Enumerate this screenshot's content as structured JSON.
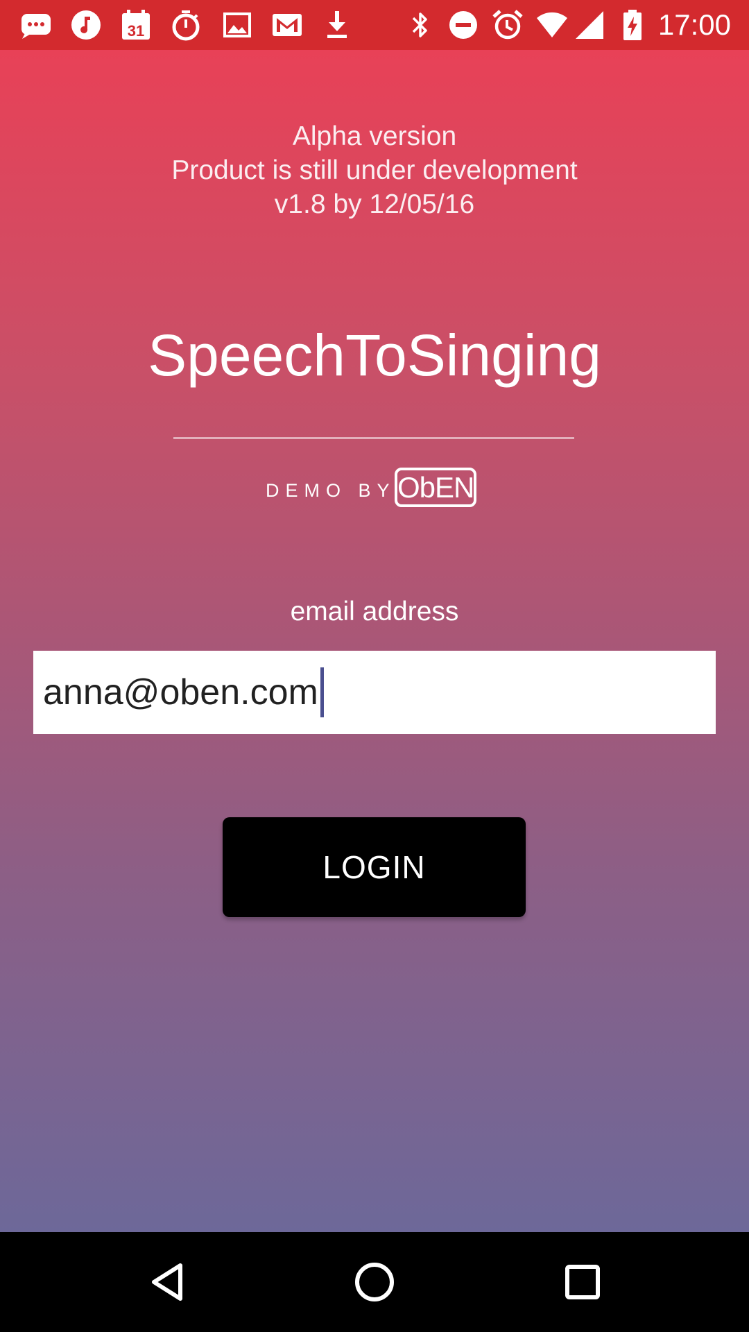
{
  "status_bar": {
    "time": "17:00",
    "notification_icons": [
      "messages-icon",
      "music-icon",
      "calendar-icon",
      "timer-icon",
      "gallery-icon",
      "gmail-icon",
      "download-icon"
    ],
    "calendar_day": "31",
    "system_icons": [
      "bluetooth-icon",
      "do-not-disturb-icon",
      "alarm-icon",
      "wifi-icon",
      "cell-signal-icon",
      "battery-charging-icon"
    ],
    "background_color": "#d32a2e"
  },
  "info": {
    "line1": "Alpha version",
    "line2": "Product is still under development",
    "line3": "v1.8 by 12/05/16"
  },
  "app": {
    "title": "SpeechToSinging",
    "demo_by": "DEMO BY",
    "brand_logo": "ObEN"
  },
  "login": {
    "email_label": "email address",
    "email_value": "anna@oben.com",
    "login_button": "LOGIN"
  },
  "nav_bar": {
    "buttons": [
      "back-icon",
      "home-icon",
      "recents-icon"
    ]
  },
  "colors": {
    "gradient_top": "#e84157",
    "gradient_bottom": "#6d6899",
    "button_bg": "#000000",
    "caret": "#4a4f8f"
  }
}
